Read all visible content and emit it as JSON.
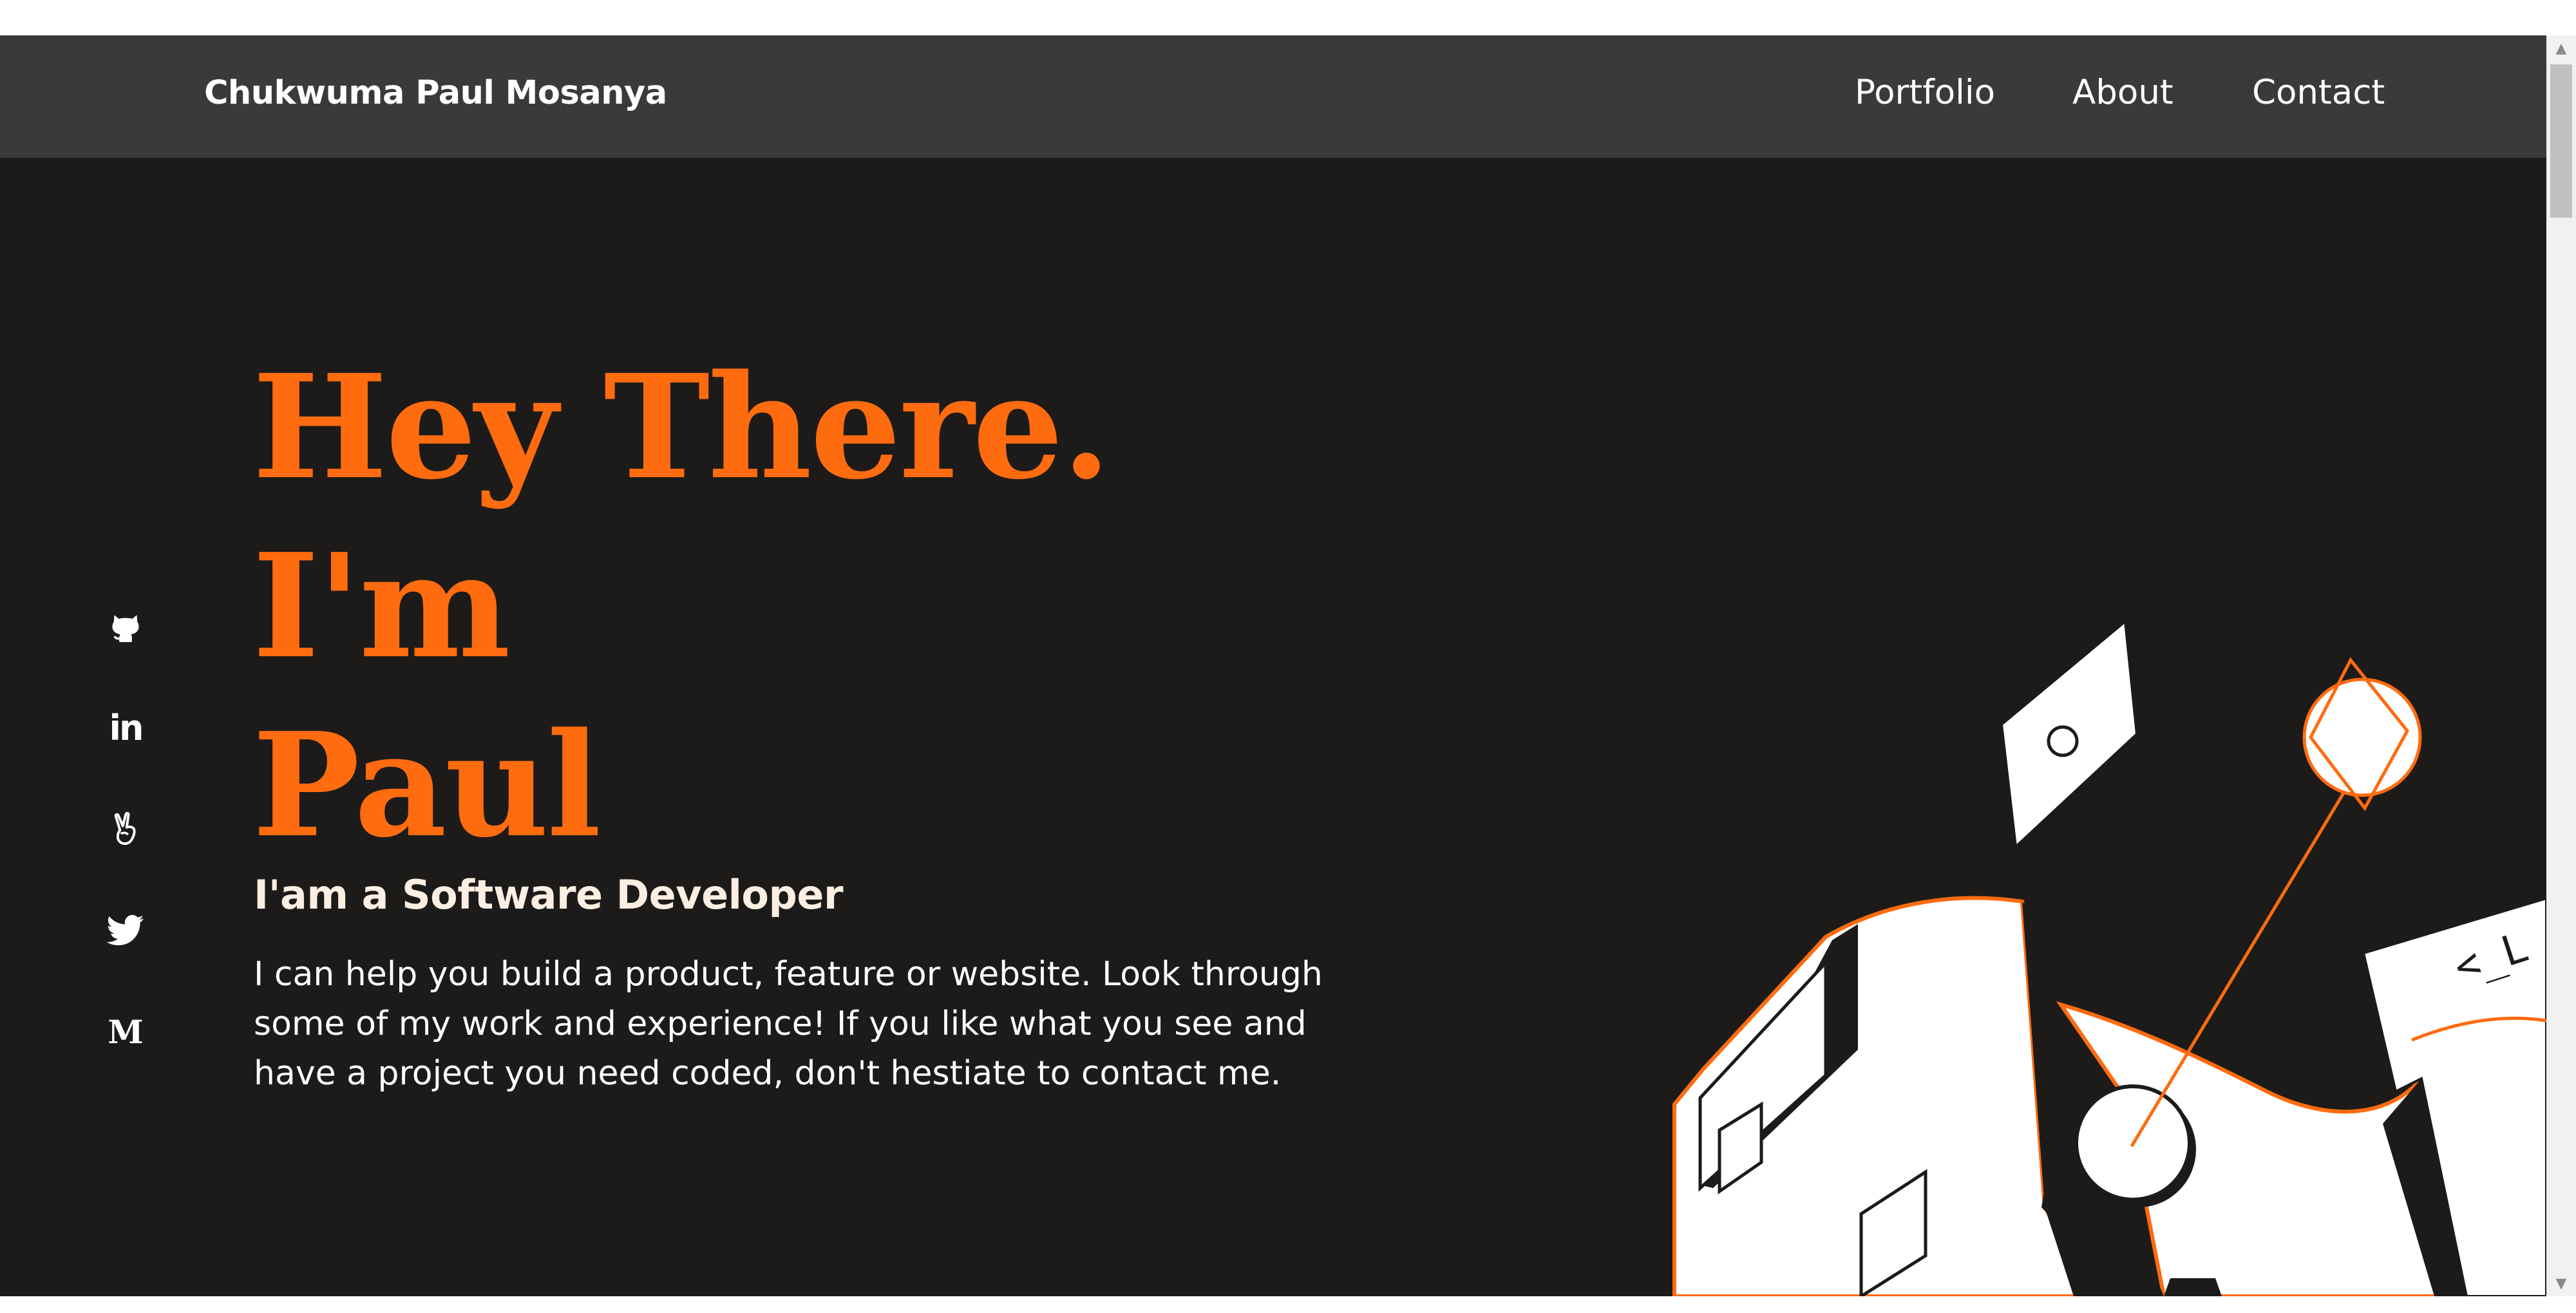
{
  "brand": "Chukwuma Paul Mosanya",
  "nav": {
    "portfolio": "Portfolio",
    "about": "About",
    "contact": "Contact"
  },
  "socials": [
    {
      "name": "github-icon"
    },
    {
      "name": "linkedin-icon",
      "text": "in"
    },
    {
      "name": "peace-hand-icon"
    },
    {
      "name": "twitter-icon"
    },
    {
      "name": "medium-icon",
      "text": "M"
    }
  ],
  "hero": {
    "title_line1": "Hey There. I'm",
    "title_line2": "Paul",
    "subtitle": "I'am a Software Developer",
    "intro": "I can help you build a product, feature or website. Look through some of my work and experience! If you like what you see and have a project you need coded, don't hestiate to contact me."
  },
  "illustration": {
    "code_tag": "<_L"
  },
  "colors": {
    "accent": "#ff6b0f",
    "background": "#1c1b1a",
    "navbar": "#3b3a39",
    "subtitle": "#fbeee2"
  }
}
